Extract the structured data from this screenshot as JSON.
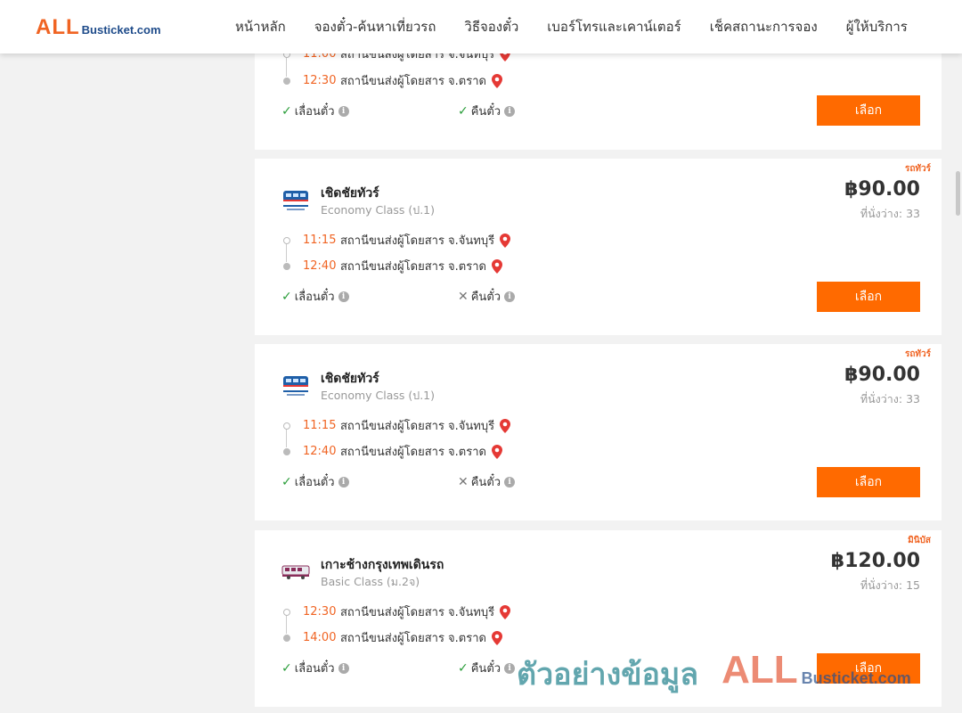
{
  "header": {
    "logo_big": "ALL",
    "logo_small": "Busticket.com",
    "nav": [
      "หน้าหลัก",
      "จองตั๋ว-ค้นหาเที่ยวรถ",
      "วิธีจองตั๋ว",
      "เบอร์โทรและเคาน์เตอร์",
      "เช็คสถานะการจอง",
      "ผู้ให้บริการ"
    ]
  },
  "top_card": {
    "stop1_time": "11:00",
    "stop1_station": "สถานีขนส่งผู้โดยสาร จ.จันทบุรี",
    "stop2_time": "12:30",
    "stop2_station": "สถานีขนส่งผู้โดยสาร จ.ตราด",
    "policy_reschedule": "เลื่อนตั๋ว",
    "policy_refund": "คืนตั๋ว",
    "select_label": "เลือก"
  },
  "trips": [
    {
      "badge": "รถทัวร์",
      "operator": "เชิดชัยทัวร์",
      "class": "Economy Class (ป.1)",
      "price": "฿90.00",
      "seats": "ที่นั่งว่าง: 33",
      "depart_time": "11:15",
      "depart_station": "สถานีขนส่งผู้โดยสาร จ.จันทบุรี",
      "arrive_time": "12:40",
      "arrive_station": "สถานีขนส่งผู้โดยสาร จ.ตราด",
      "reschedule": "เลื่อนตั๋ว",
      "refund": "คืนตั๋ว",
      "select_label": "เลือก"
    },
    {
      "badge": "รถทัวร์",
      "operator": "เชิดชัยทัวร์",
      "class": "Economy Class (ป.1)",
      "price": "฿90.00",
      "seats": "ที่นั่งว่าง: 33",
      "depart_time": "11:15",
      "depart_station": "สถานีขนส่งผู้โดยสาร จ.จันทบุรี",
      "arrive_time": "12:40",
      "arrive_station": "สถานีขนส่งผู้โดยสาร จ.ตราด",
      "reschedule": "เลื่อนตั๋ว",
      "refund": "คืนตั๋ว",
      "select_label": "เลือก"
    },
    {
      "badge": "มินิบัส",
      "operator": "เกาะช้างกรุงเทพเดินรถ",
      "class": "Basic Class (ม.2จ)",
      "price": "฿120.00",
      "seats": "ที่นั่งว่าง: 15",
      "depart_time": "12:30",
      "depart_station": "สถานีขนส่งผู้โดยสาร จ.จันทบุรี",
      "arrive_time": "14:00",
      "arrive_station": "สถานีขนส่งผู้โดยสาร จ.ตราด",
      "reschedule": "เลื่อนตั๋ว",
      "refund": "คืนตั๋ว",
      "select_label": "เลือก"
    }
  ],
  "watermark": {
    "text": "ตัวอย่างข้อมูล",
    "brand_big": "ALL",
    "brand_small": "Busticket.com"
  },
  "colors": {
    "accent": "#ff6a00",
    "time": "#f06423",
    "check": "#2a9d3a",
    "pin": "#e53935"
  }
}
